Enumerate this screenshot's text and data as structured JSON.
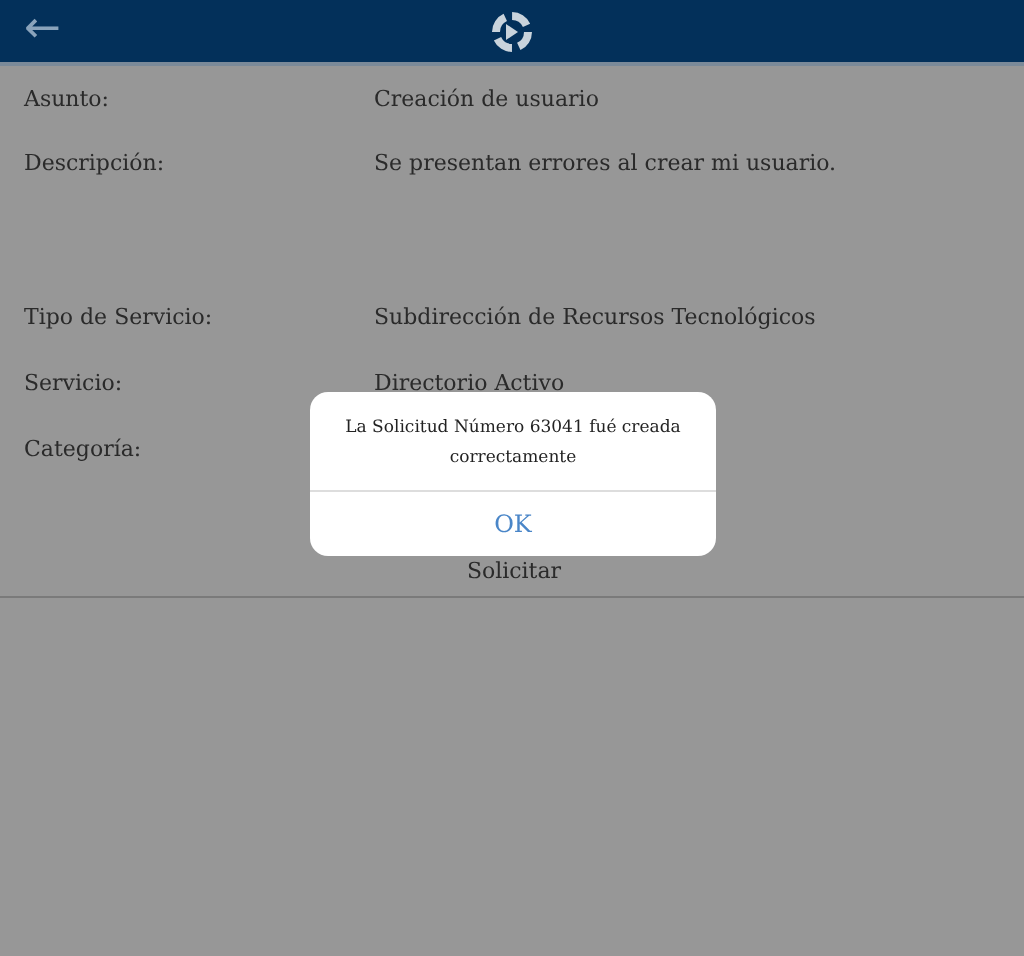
{
  "header": {
    "back": "←"
  },
  "fields": [
    {
      "label": "Asunto:",
      "value": "Creación de usuario",
      "kind": "short"
    },
    {
      "label": "Descripción:",
      "value": "Se presentan errores al crear mi usuario.",
      "kind": "long"
    },
    {
      "label": "Tipo de Servicio:",
      "value": "Subdirección de Recursos Tecnológicos",
      "kind": "short"
    },
    {
      "label": "Servicio:",
      "value": "Directorio Activo",
      "kind": "short"
    },
    {
      "label": "Categoría:",
      "kind": "short"
    }
  ],
  "submit_button": "Solicitar",
  "dialog": {
    "message": "La Solicitud Número 63041 fué creada correctamente",
    "button": "OK"
  }
}
